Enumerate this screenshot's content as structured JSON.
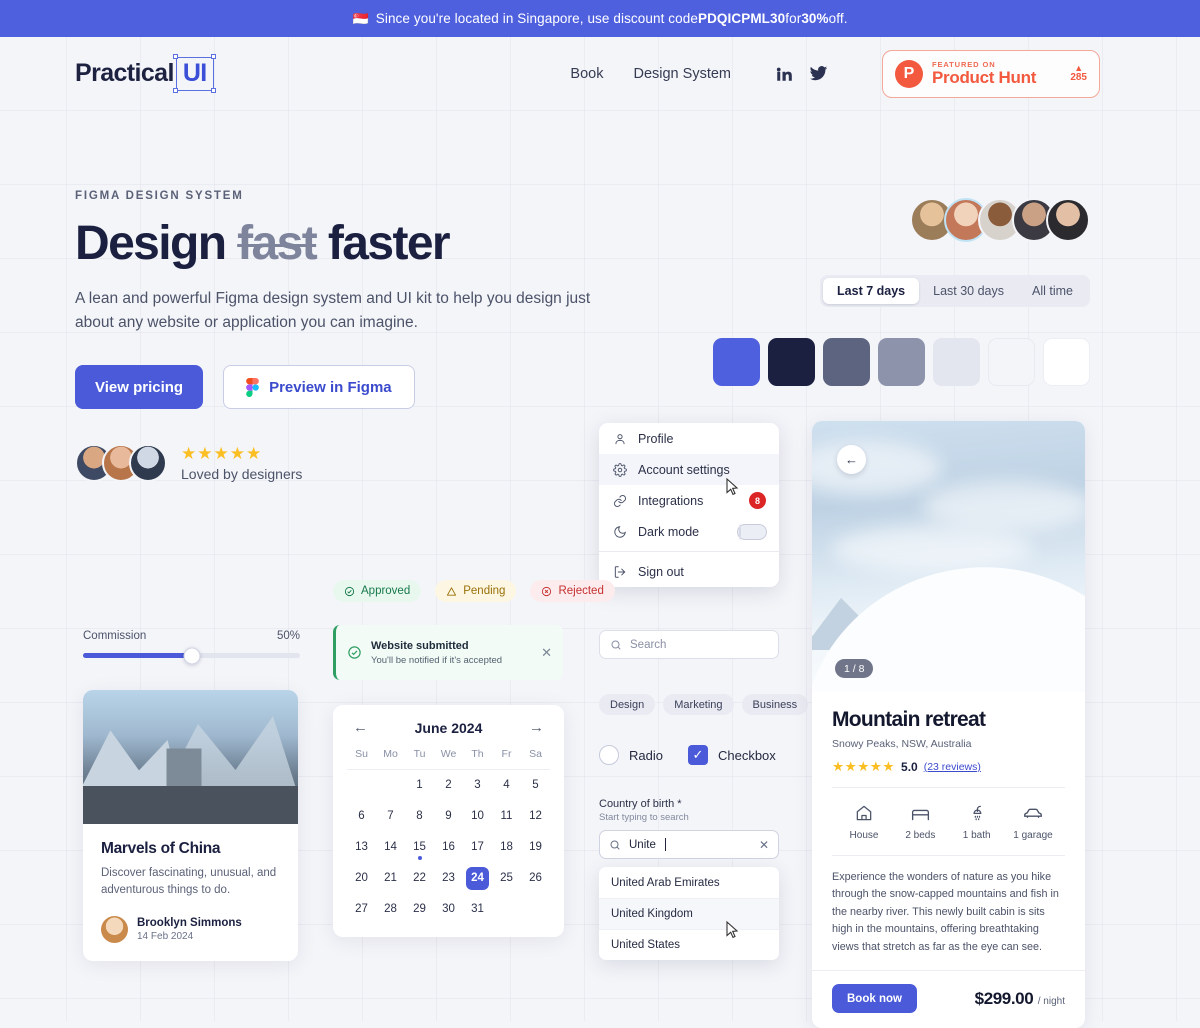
{
  "announcement": {
    "flag": "🇸🇬",
    "prefix": "Since you're located in Singapore, use discount code ",
    "code": "PDQICPML30",
    "middle": " for ",
    "discount": "30%",
    "suffix": " off."
  },
  "header": {
    "logo_text": "Practical",
    "logo_badge": "UI",
    "nav": [
      {
        "label": "Book",
        "name": "nav-book"
      },
      {
        "label": "Design System",
        "name": "nav-design-system"
      }
    ],
    "social": [
      {
        "name": "linkedin-icon",
        "label": "in"
      },
      {
        "name": "twitter-icon",
        "label": "twitter"
      }
    ],
    "product_hunt": {
      "mark": "P",
      "featured_on": "FEATURED ON",
      "title": "Product Hunt",
      "triangle": "▲",
      "votes": "285"
    }
  },
  "hero": {
    "eyebrow": "FIGMA DESIGN SYSTEM",
    "title_pre": "Design ",
    "title_strike": "fast",
    "title_post": " faster",
    "subtitle": "A lean and powerful Figma design system and UI kit to help you design just about any website or application you can imagine.",
    "primary_cta": "View pricing",
    "secondary_cta": "Preview in Figma",
    "stars": "★★★★★",
    "loved_label": "Loved by designers"
  },
  "segmented": {
    "options": [
      "Last 7 days",
      "Last 30 days",
      "All time"
    ],
    "selected": "Last 7 days"
  },
  "swatches": {
    "colors": [
      "#4f60df",
      "#1b2040",
      "#5d6480",
      "#8d93ab",
      "#e3e5ef",
      "#f4f5f9",
      "#ffffff"
    ]
  },
  "menu": {
    "items": [
      {
        "label": "Profile",
        "icon": "user-icon"
      },
      {
        "label": "Account settings",
        "icon": "gear-icon"
      },
      {
        "label": "Integrations",
        "icon": "link-icon",
        "badge": "8"
      },
      {
        "label": "Dark mode",
        "icon": "moon-icon",
        "toggle": "off"
      },
      {
        "label": "Sign out",
        "icon": "sign-out-icon"
      }
    ]
  },
  "status_pills": [
    {
      "label": "Approved",
      "icon": "check-circle-icon",
      "color": "#17794a"
    },
    {
      "label": "Pending",
      "icon": "warning-triangle-icon",
      "color": "#9a7108"
    },
    {
      "label": "Rejected",
      "icon": "x-circle-icon",
      "color": "#c53030"
    }
  ],
  "alert": {
    "title": "Website submitted",
    "description": "You'll be notified if it's accepted",
    "close": "✕",
    "accent": "#2f9e63"
  },
  "slider": {
    "label": "Commission",
    "value": "50%"
  },
  "article_card": {
    "title": "Marvels of China",
    "excerpt": "Discover fascinating, unusual, and adventurous things to do.",
    "author": "Brooklyn Simmons",
    "date": "14 Feb 2024"
  },
  "calendar": {
    "month": "June 2024",
    "prev": "←",
    "next": "→",
    "weekdays": [
      "Su",
      "Mo",
      "Tu",
      "We",
      "Th",
      "Fr",
      "Sa"
    ],
    "weeks": [
      [
        "",
        "",
        "1",
        "2",
        "3",
        "4",
        "5"
      ],
      [
        "6",
        "7",
        "8",
        "9",
        "10",
        "11",
        "12"
      ],
      [
        "13",
        "14",
        "15",
        "16",
        "17",
        "18",
        "19"
      ],
      [
        "20",
        "21",
        "22",
        "23",
        "24",
        "25",
        "26"
      ],
      [
        "27",
        "28",
        "29",
        "30",
        "31",
        "",
        ""
      ]
    ],
    "selected": "24",
    "dotted": "15"
  },
  "search": {
    "placeholder": "Search"
  },
  "chips": [
    "Design",
    "Marketing",
    "Business"
  ],
  "choices": {
    "radio_label": "Radio",
    "checkbox_label": "Checkbox",
    "checkbox_checked": true,
    "check_glyph": "✓"
  },
  "country_select": {
    "label": "Country of birth *",
    "hint": "Start typing to search",
    "value": "Unite",
    "clear": "✕",
    "options": [
      "United Arab Emirates",
      "United Kingdom",
      "United States"
    ],
    "highlighted": "United Kingdom"
  },
  "property": {
    "back": "←",
    "photo_count": "1 / 8",
    "title": "Mountain retreat",
    "location": "Snowy Peaks, NSW, Australia",
    "stars": "★★★★★",
    "rating": "5.0",
    "reviews": "(23 reviews)",
    "features": [
      {
        "label": "House",
        "icon": "house-icon"
      },
      {
        "label": "2 beds",
        "icon": "bed-icon"
      },
      {
        "label": "1 bath",
        "icon": "shower-icon"
      },
      {
        "label": "1 garage",
        "icon": "car-icon"
      }
    ],
    "description": "Experience the wonders of nature as you hike through the snow-capped mountains and fish in the nearby river. This newly built cabin is sits high in the mountains, offering breathtaking views that stretch as far as the eye can see.",
    "book_label": "Book now",
    "price": "$299.00",
    "per": "/ night"
  }
}
